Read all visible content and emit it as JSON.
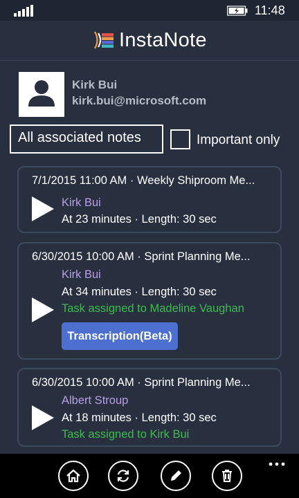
{
  "status_bar": {
    "time": "11:48"
  },
  "header": {
    "app_title": "InstaNote"
  },
  "profile": {
    "name": "Kirk Bui",
    "email": "kirk.bui@microsoft.com"
  },
  "filters": {
    "all_notes_label": "All associated notes",
    "important_only_label": "Important only",
    "important_only_checked": false
  },
  "notes": [
    {
      "title": "7/1/2015 11:00 AM · Weekly Shiproom Me...",
      "author": "Kirk Bui",
      "meta": "At 23 minutes · Length: 30 sec"
    },
    {
      "title": "6/30/2015 10:00 AM · Sprint Planning Me...",
      "author": "Kirk Bui",
      "meta": "At 34 minutes · Length: 30 sec",
      "task": "Task assigned to Madeline Vaughan",
      "button": "Transcription(Beta)"
    },
    {
      "title": "6/30/2015 10:00 AM · Sprint Planning Me...",
      "author": "Albert Stroup",
      "meta": "At 18 minutes · Length: 30 sec",
      "task": "Task assigned to Kirk Bui"
    }
  ],
  "app_bar": {
    "icons": [
      "home-icon",
      "sync-icon",
      "edit-icon",
      "delete-icon",
      "more-icon"
    ]
  },
  "colors": {
    "background": "#283040",
    "author": "#b89ee8",
    "task": "#3fb950",
    "button": "#4d6fd0"
  }
}
